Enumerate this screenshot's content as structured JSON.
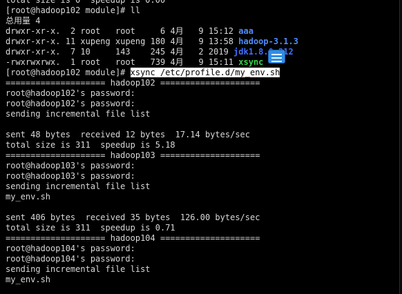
{
  "terminal": {
    "lines": [
      "total size is 0  speedup is 0.00",
      "[root@hadoop102 module]# ll",
      "总用量 4",
      {
        "perm": "drwxr-xr-x.",
        "links": " 2",
        "owner": "root",
        "group": "root",
        "size": "6",
        "month": "4月",
        "day": "9",
        "time": "15:12",
        "name": "aaa",
        "kind": "dir"
      },
      {
        "perm": "drwxr-xr-x.",
        "links": "11",
        "owner": "xupeng",
        "group": "xupeng",
        "size": "180",
        "month": "4月",
        "day": "9",
        "time": "13:58",
        "name": "hadoop-3.1.3",
        "kind": "dir"
      },
      {
        "perm": "drwxr-xr-x.",
        "links": " 7",
        "owner": "10",
        "group": "143",
        "size": "245",
        "month": "4月",
        "day": "2",
        "time": "2019",
        "name": "jdk1.8.0_212",
        "kind": "dir-hi"
      },
      {
        "perm": "-rwxrwxrwx.",
        "links": " 1",
        "owner": "root",
        "group": "root",
        "size": "739",
        "month": "4月",
        "day": "9",
        "time": "15:11",
        "name": "xsync",
        "kind": "exec"
      },
      {
        "prompt": "[root@hadoop102 module]# ",
        "command": "xsync /etc/profile.d/my_env.sh"
      },
      "==================== hadoop102 ====================",
      "root@hadoop102's password:",
      "root@hadoop102's password:",
      "sending incremental file list",
      "",
      "sent 48 bytes  received 12 bytes  17.14 bytes/sec",
      "total size is 311  speedup is 5.18",
      "==================== hadoop103 ====================",
      "root@hadoop103's password:",
      "root@hadoop103's password:",
      "sending incremental file list",
      "my_env.sh",
      "",
      "sent 406 bytes  received 35 bytes  126.00 bytes/sec",
      "total size is 311  speedup is 0.71",
      "==================== hadoop104 ====================",
      "root@hadoop104's password:",
      "root@hadoop104's password:",
      "sending incremental file list",
      "my_env.sh",
      ""
    ],
    "colors": {
      "background": "#000000",
      "text": "#d8d8d8",
      "directory": "#4f8bff",
      "directory_highlight": "#3f6fff",
      "executable": "#34d54a",
      "selection_background": "#ffffff",
      "selection_text": "#000000",
      "overlay_icon": "#2f8de6"
    },
    "overlay_icon": "input-method-icon"
  }
}
